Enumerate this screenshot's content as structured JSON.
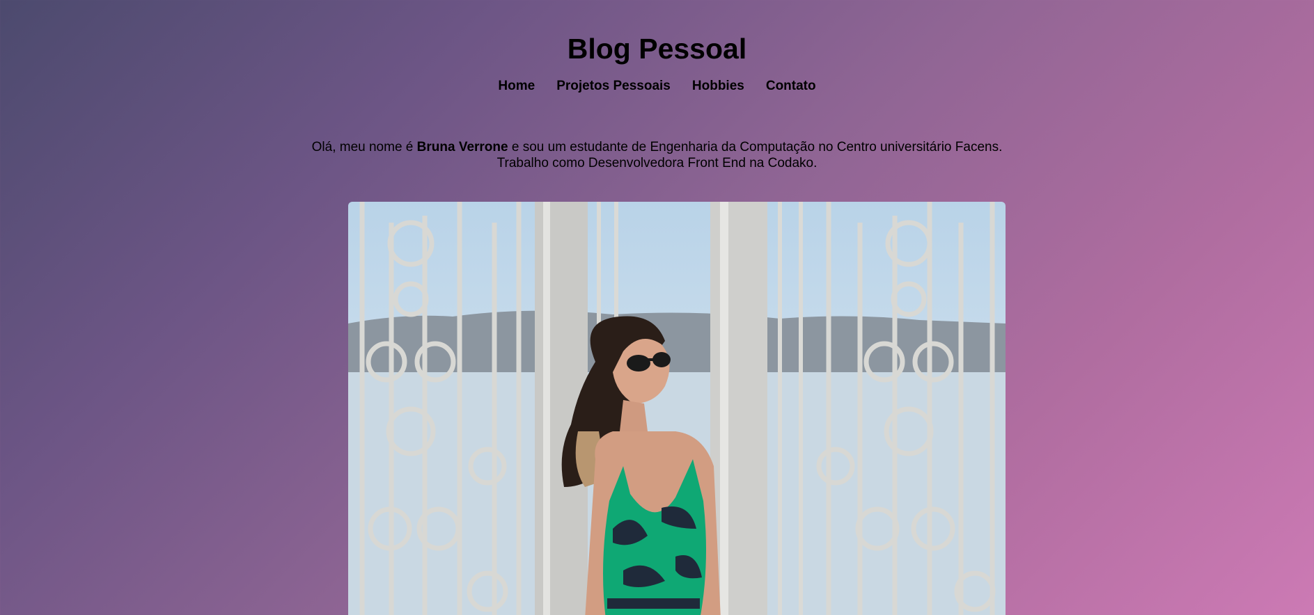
{
  "header": {
    "title": "Blog Pessoal",
    "nav": [
      "Home",
      "Projetos Pessoais",
      "Hobbies",
      "Contato"
    ]
  },
  "intro": {
    "prefix": "Olá, meu nome é ",
    "name": "Bruna Verrone",
    "suffix": " e sou um estudante de Engenharia da Computação no Centro universitário Facens.",
    "line2": "Trabalho como Desenvolvedora Front End na Codako."
  },
  "photo": {
    "description_icon": "portrait-photo"
  },
  "colors": {
    "gradient_start": "#4c4a6e",
    "gradient_end": "#cc7ab4",
    "text": "#000000",
    "dress_green": "#0fa874",
    "dress_dark": "#1f2a3a"
  }
}
